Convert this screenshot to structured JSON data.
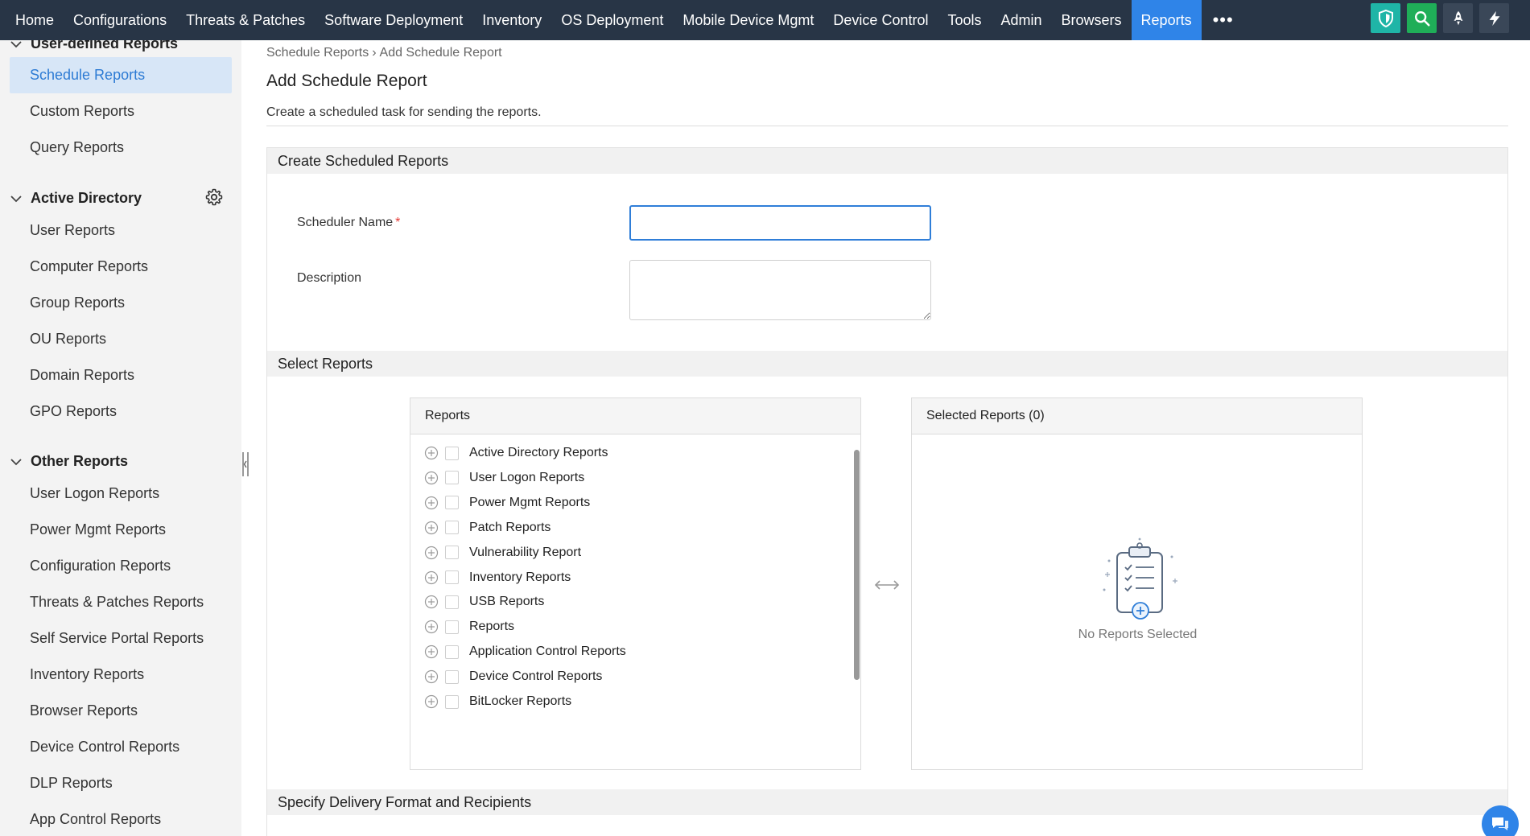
{
  "nav": {
    "items": [
      "Home",
      "Configurations",
      "Threats & Patches",
      "Software Deployment",
      "Inventory",
      "OS Deployment",
      "Mobile Device Mgmt",
      "Device Control",
      "Tools",
      "Admin",
      "Browsers",
      "Reports"
    ],
    "active": "Reports",
    "more": "•••",
    "icons": [
      "shield-icon",
      "search-icon",
      "rocket-icon",
      "bolt-icon"
    ],
    "colors": {
      "bar": "#283546",
      "active": "#2f84e8",
      "shield": "#1fb5a7",
      "search": "#1fae58"
    }
  },
  "sidebar": {
    "sections": [
      {
        "title": "User-defined Reports",
        "items": [
          "Schedule Reports",
          "Custom Reports",
          "Query Reports"
        ]
      },
      {
        "title": "Active Directory",
        "items": [
          "User Reports",
          "Computer Reports",
          "Group Reports",
          "OU Reports",
          "Domain Reports",
          "GPO Reports"
        ]
      },
      {
        "title": "Other Reports",
        "items": [
          "User Logon Reports",
          "Power Mgmt Reports",
          "Configuration Reports",
          "Threats & Patches Reports",
          "Self Service Portal Reports",
          "Inventory Reports",
          "Browser Reports",
          "Device Control Reports",
          "DLP Reports",
          "App Control Reports"
        ]
      }
    ],
    "active_item": "Schedule Reports"
  },
  "breadcrumb": {
    "parent": "Schedule Reports",
    "separator": "›",
    "current": "Add Schedule Report"
  },
  "page": {
    "title": "Add Schedule Report",
    "description": "Create a scheduled task for sending the reports."
  },
  "form": {
    "section_create": "Create Scheduled Reports",
    "scheduler_name_label": "Scheduler Name",
    "required_mark": "*",
    "scheduler_name_value": "",
    "description_label": "Description",
    "description_value": "",
    "section_select": "Select Reports",
    "reports_header": "Reports",
    "report_list": [
      "Active Directory Reports",
      "User Logon Reports",
      "Power Mgmt Reports",
      "Patch Reports",
      "Vulnerability Report",
      "Inventory Reports",
      "USB Reports",
      "Reports",
      "Application Control Reports",
      "Device Control Reports",
      "BitLocker Reports"
    ],
    "selected_header": "Selected Reports (0)",
    "empty_text": "No Reports Selected",
    "section_delivery": "Specify Delivery Format and Recipients"
  }
}
